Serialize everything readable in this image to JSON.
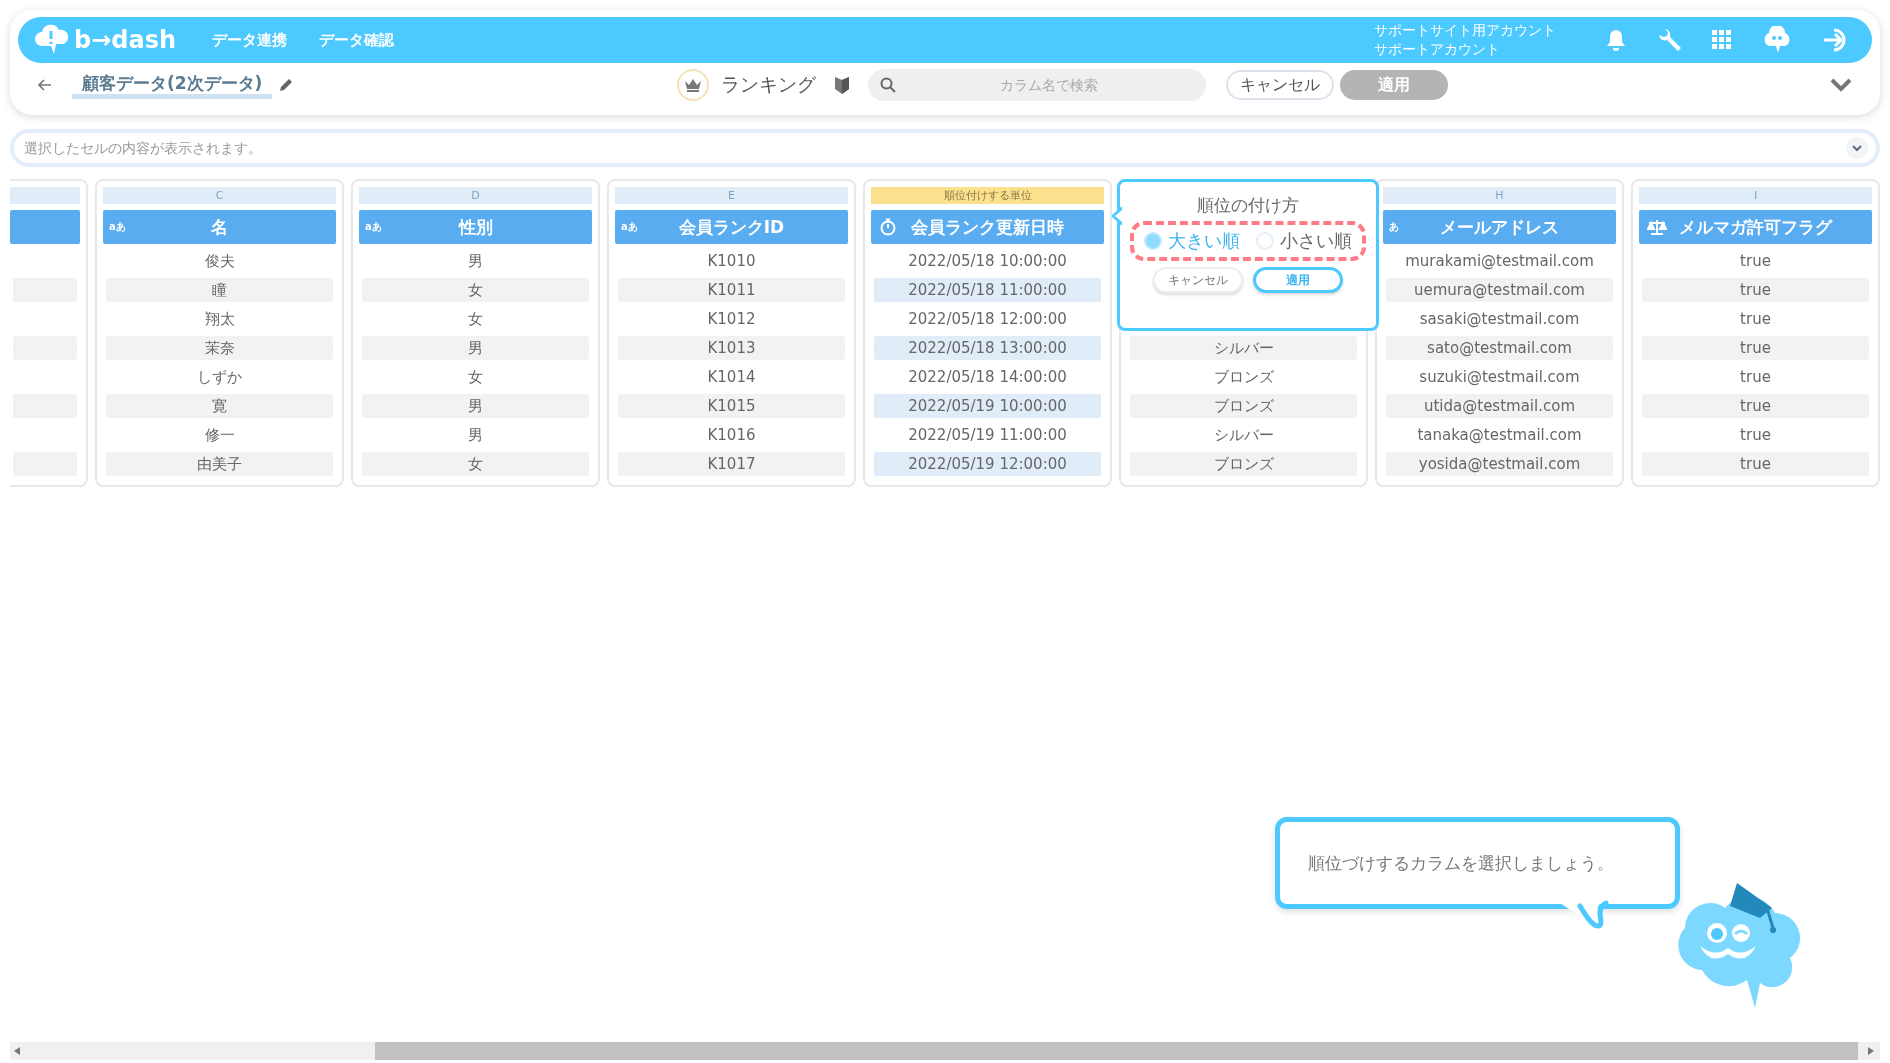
{
  "header": {
    "logo": "b→dash",
    "nav": [
      {
        "label": "データ連携"
      },
      {
        "label": "データ確認"
      }
    ],
    "account": [
      "サポートサイト用アカウント",
      "サポートアカウント"
    ]
  },
  "toolbar": {
    "title": "顧客データ(2次データ)",
    "mode": "ランキング",
    "search": {
      "placeholder": "カラム名で検索"
    },
    "cancel": "キャンセル",
    "apply": {
      "label": "適用",
      "disabled": true
    }
  },
  "preview": {
    "placeholder": "選択したセルの内容が表示されます。"
  },
  "columns": [
    {
      "kind": "cut",
      "rows": [
        "",
        "",
        "",
        "",
        "",
        "",
        "",
        ""
      ]
    },
    {
      "letter": "C",
      "kind": "text",
      "type_label": "aあ",
      "header": "名",
      "selected": false,
      "rows": [
        "俊夫",
        "瞳",
        "翔太",
        "茉奈",
        "しずか",
        "寛",
        "修一",
        "由美子"
      ]
    },
    {
      "letter": "D",
      "kind": "text",
      "type_label": "aあ",
      "header": "性別",
      "selected": false,
      "rows": [
        "男",
        "女",
        "女",
        "男",
        "女",
        "男",
        "男",
        "女"
      ]
    },
    {
      "letter": "E",
      "kind": "text",
      "type_label": "aあ",
      "header": "会員ランクID",
      "selected": false,
      "rows": [
        "K1010",
        "K1011",
        "K1012",
        "K1013",
        "K1014",
        "K1015",
        "K1016",
        "K1017"
      ]
    },
    {
      "letter": "順位付けする単位",
      "kind": "datetime",
      "header": "会員ランク更新日時",
      "selected": true,
      "rows": [
        "2022/05/18 10:00:00",
        "2022/05/18 11:00:00",
        "2022/05/18 12:00:00",
        "2022/05/18 13:00:00",
        "2022/05/18 14:00:00",
        "2022/05/19 10:00:00",
        "2022/05/19 11:00:00",
        "2022/05/19 12:00:00"
      ]
    },
    {
      "kind": "covered",
      "rows": [
        "シルバー",
        "ブロンズ",
        "ブロンズ",
        "シルバー",
        "ブロンズ"
      ]
    },
    {
      "letter": "H",
      "kind": "text",
      "type_label": "あ",
      "header": "メールアドレス",
      "selected": false,
      "rows": [
        "murakami@testmail.com",
        "uemura@testmail.com",
        "sasaki@testmail.com",
        "sato@testmail.com",
        "suzuki@testmail.com",
        "utida@testmail.com",
        "tanaka@testmail.com",
        "yosida@testmail.com"
      ]
    },
    {
      "letter": "I",
      "kind": "boolean",
      "header": "メルマガ許可フラグ",
      "selected": false,
      "rows": [
        "true",
        "true",
        "true",
        "true",
        "true",
        "true",
        "true",
        "true"
      ]
    }
  ],
  "rank_popup": {
    "title": "順位の付け方",
    "options": [
      {
        "label": "大きい順",
        "selected": true
      },
      {
        "label": "小さい順",
        "selected": false
      }
    ],
    "cancel": "キャンセル",
    "apply": "適用"
  },
  "tutorial": {
    "message": "順位づけするカラムを選択しましょう。"
  }
}
